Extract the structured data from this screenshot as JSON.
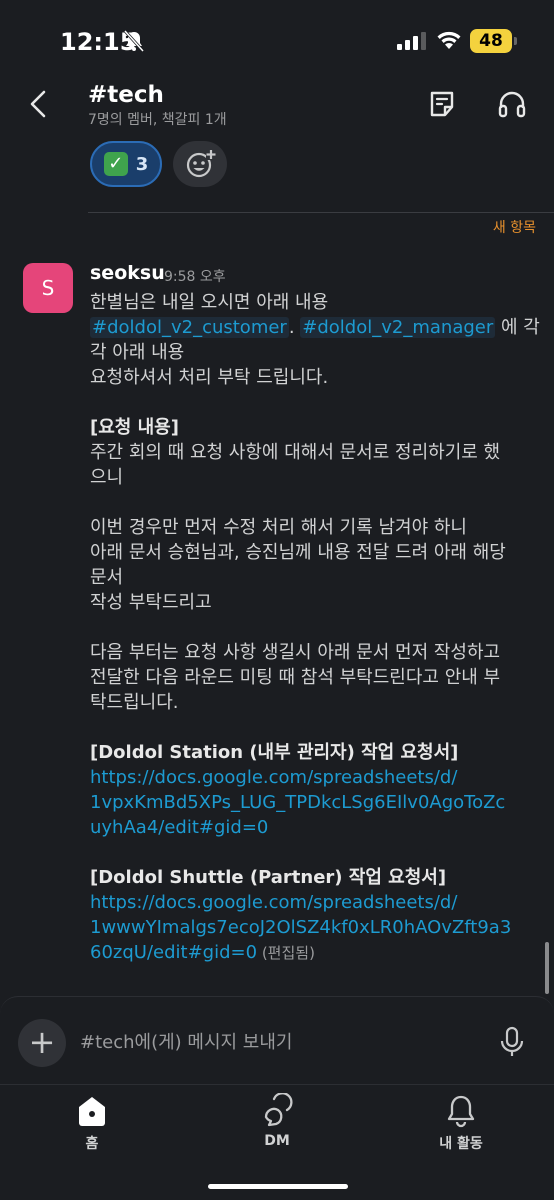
{
  "status": {
    "time": "12:15",
    "battery": "48"
  },
  "header": {
    "title": "#tech",
    "subtitle": "7명의 멤버, 책갈피 1개"
  },
  "reactions": {
    "check_count": "3",
    "check_emoji": "✓"
  },
  "divider": {
    "new_label": "새 항목"
  },
  "message": {
    "avatar_letter": "S",
    "author": "seoksu",
    "time": "9:58 오후",
    "line1": "한별님은 내일 오시면 아래 내용",
    "mention1": "#doldol_v2_customer",
    "sep": ". ",
    "mention2": "#doldol_v2_manager",
    "line2_tail": " 에 각",
    "line3": "각 아래 내용",
    "line4": "요청하셔서 처리 부탁 드립니다.",
    "req_heading": "[요청 내용]",
    "req1": "주간 회의 때 요청 사항에 대해서 문서로 정리하기로 했",
    "req2": "으니",
    "p2_1": "이번 경우만 먼저 수정 처리 해서 기록 남겨야 하니",
    "p2_2": "아래 문서 승현님과, 승진님께 내용 전달 드려 아래 해당",
    "p2_3": "문서",
    "p2_4": "작성 부탁드리고",
    "p3_1": "다음 부터는 요청 사항 생길시 아래 문서 먼저 작성하고",
    "p3_2": "전달한 다음 라운드 미팅  때 참석 부탁드린다고 안내 부",
    "p3_3": "탁드립니다.",
    "doc1_title": "[Doldol Station (내부 관리자) 작업 요청서]",
    "doc1_url_1": "https://docs.google.com/spreadsheets/d/",
    "doc1_url_2": "1vpxKmBd5XPs_LUG_TPDkcLSg6EIlv0AgoToZc",
    "doc1_url_3": "uyhAa4/edit#gid=0",
    "doc2_title": "[Doldol Shuttle (Partner) 작업 요청서]",
    "doc2_url_1": "https://docs.google.com/spreadsheets/d/",
    "doc2_url_2": "1wwwYImalgs7ecoJ2OlSZ4kf0xLR0hAOvZft9a3",
    "doc2_url_3": "60zqU/edit#gid=0",
    "edited": " (편집됨)"
  },
  "composer": {
    "placeholder": "#tech에(게) 메시지 보내기",
    "plus": "+"
  },
  "nav": {
    "home": "홈",
    "dm": "DM",
    "activity": "내 활동"
  },
  "icons": {
    "status": [
      "bell-off-icon",
      "signal-icon",
      "wifi-icon",
      "battery-icon"
    ],
    "header": [
      "back-arrow-icon",
      "canvas-icon",
      "headphones-icon"
    ],
    "composer": [
      "plus-icon",
      "microphone-icon"
    ],
    "nav": [
      "home-icon",
      "dm-icon",
      "bell-icon"
    ]
  },
  "colors": {
    "background": "#1b1d21",
    "link": "#1d9bd1",
    "new_label": "#e8912d",
    "avatar": "#e5457a",
    "reaction_bg": "#1a3e6b",
    "battery": "#f4d23e"
  }
}
